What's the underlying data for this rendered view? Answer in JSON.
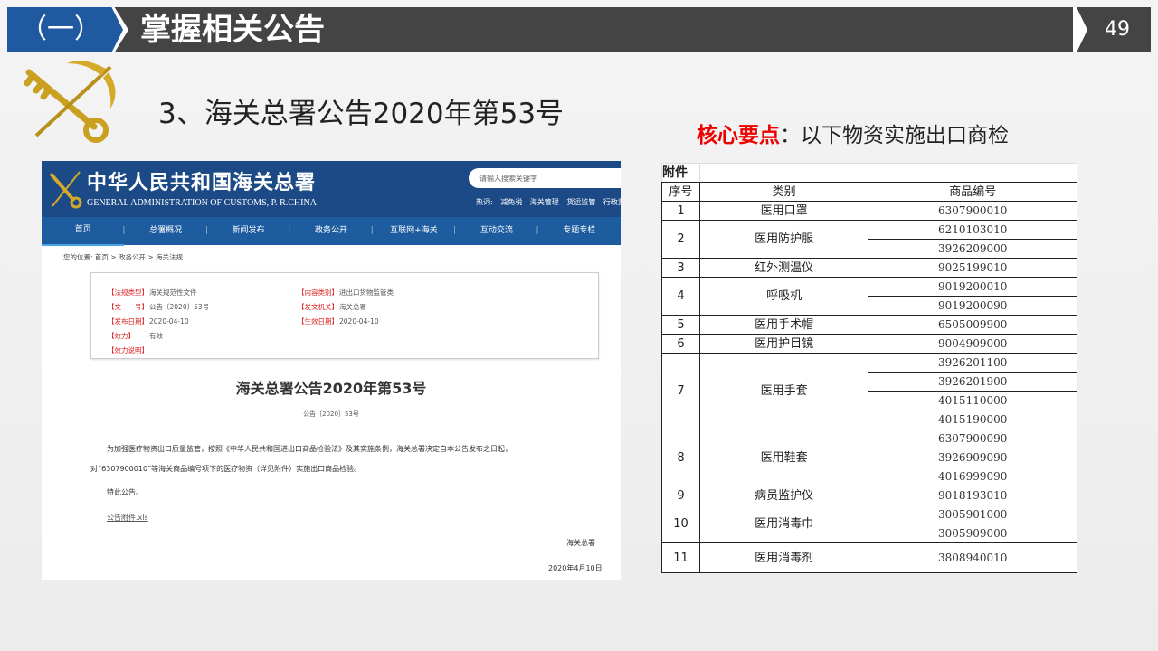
{
  "header": {
    "section": "（一）",
    "title": "掌握相关公告",
    "page": "49"
  },
  "subtitle": "3、海关总署公告2020年第53号",
  "core": {
    "key": "核心要点",
    "text": "：以下物资实施出口商检"
  },
  "screenshot": {
    "site_name_cn": "中华人民共和国海关总署",
    "site_name_en": "GENERAL ADMINISTRATION OF CUSTOMS, P. R.CHINA",
    "search_placeholder": "请输入搜索关键字",
    "hot_label": "热词:",
    "hot_words": [
      "减免税",
      "海关管理",
      "货运监管",
      "行政监管"
    ],
    "nav": [
      "首页",
      "总署概况",
      "新闻发布",
      "政务公开",
      "互联网+海关",
      "互动交流",
      "专题专栏"
    ],
    "breadcrumb": "您的位置: 首页 > 政务公开 > 海关法规",
    "meta": {
      "type_label": "【法规类型】",
      "type": "海关规范性文件",
      "content_label": "【内容类别】",
      "content": "进出口货物监管类",
      "no_label": "【文　　号】",
      "no": "公告〔2020〕53号",
      "issuer_label": "【发文机关】",
      "issuer": "海关总署",
      "date_label": "【发布日期】",
      "date": "2020-04-10",
      "effective_label": "【生效日期】",
      "effective": "2020-04-10",
      "validity_label": "【效力】",
      "validity": "有效",
      "validity_note_label": "【效力说明】"
    },
    "doc_title": "海关总署公告2020年第53号",
    "doc_no": "公告〔2020〕53号",
    "body1": "为加强医疗物资出口质量监管，按照《中华人民共和国进出口商品检验法》及其实施条例，海关总署决定自本公告发布之日起，",
    "body2": "对“6307900010”等海关商品编号项下的医疗物资（详见附件）实施出口商品检验。",
    "body3": "特此公告。",
    "attachment": "公告附件.xls",
    "signer": "海关总署",
    "sign_date": "2020年4月10日"
  },
  "table": {
    "caption": "附件",
    "headers": [
      "序号",
      "类别",
      "商品编号"
    ],
    "rows": [
      {
        "no": "1",
        "category": "医用口罩",
        "codes": [
          "6307900010"
        ]
      },
      {
        "no": "2",
        "category": "医用防护服",
        "codes": [
          "6210103010",
          "3926209000"
        ]
      },
      {
        "no": "3",
        "category": "红外测温仪",
        "codes": [
          "9025199010"
        ]
      },
      {
        "no": "4",
        "category": "呼吸机",
        "codes": [
          "9019200010",
          "9019200090"
        ]
      },
      {
        "no": "5",
        "category": "医用手术帽",
        "codes": [
          "6505009900"
        ]
      },
      {
        "no": "6",
        "category": "医用护目镜",
        "codes": [
          "9004909000"
        ]
      },
      {
        "no": "7",
        "category": "医用手套",
        "codes": [
          "3926201100",
          "3926201900",
          "4015110000",
          "4015190000"
        ]
      },
      {
        "no": "8",
        "category": "医用鞋套",
        "codes": [
          "6307900090",
          "3926909090",
          "4016999090"
        ]
      },
      {
        "no": "9",
        "category": "病员监护仪",
        "codes": [
          "9018193010"
        ]
      },
      {
        "no": "10",
        "category": "医用消毒巾",
        "codes": [
          "3005901000",
          "3005909000"
        ]
      },
      {
        "no": "11",
        "category": "医用消毒剂",
        "codes": [
          "3808940010"
        ]
      }
    ]
  }
}
